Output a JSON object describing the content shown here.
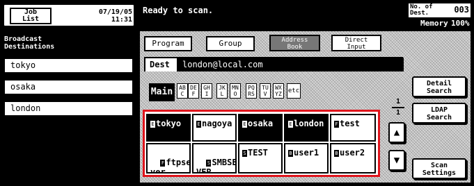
{
  "job_list": {
    "label": "Job\nList",
    "date": "07/19/05",
    "time": "11:31"
  },
  "status": {
    "message": "Ready to scan.",
    "no_of_dest_label": "No. of\nDest.",
    "dest_count": "003",
    "memory_label": "Memory",
    "memory_value": "100%"
  },
  "broadcast": {
    "title": "Broadcast\nDestinations",
    "items": [
      "tokyo",
      "osaka",
      "london"
    ]
  },
  "tabs": [
    {
      "label": "Program",
      "active": false
    },
    {
      "label": "Group",
      "active": false
    },
    {
      "label": "Address\nBook",
      "active": true
    },
    {
      "label": "Direct\nInput",
      "active": false
    }
  ],
  "dest": {
    "label": "Dest",
    "value": "london@local.com"
  },
  "index": {
    "main_label": "Main",
    "letters": [
      "AB\nC",
      "DE\nF",
      "GH\nI",
      "JK\nL",
      "MN\nO",
      "PQ\nRS",
      "TU\nV",
      "WX\nYZ",
      "etc"
    ]
  },
  "address_cells": [
    {
      "icon": "E",
      "label": "tokyo",
      "selected": true
    },
    {
      "icon": "E",
      "label": "nagoya",
      "selected": false
    },
    {
      "icon": "E",
      "label": "osaka",
      "selected": true
    },
    {
      "icon": "E",
      "label": "london",
      "selected": true
    },
    {
      "icon": "F",
      "label": "test",
      "selected": false
    },
    {
      "icon": "F",
      "label": "ftpser\nver",
      "selected": false
    },
    {
      "icon": "S",
      "label": "SMBSER\nVER",
      "selected": false
    },
    {
      "icon": "S",
      "label": "TEST",
      "selected": false
    },
    {
      "icon": "B",
      "label": "user1",
      "selected": false
    },
    {
      "icon": "B",
      "label": "user2",
      "selected": false
    }
  ],
  "page": {
    "current": "1",
    "total": "1"
  },
  "buttons": {
    "detail_search": "Detail\nSearch",
    "ldap_search": "LDAP\nSearch",
    "scan_settings": "Scan\nSettings"
  },
  "colors": {
    "highlight_border": "#e0141c",
    "selected_fill": "#000000",
    "background_dither": "#d6d6d6"
  }
}
